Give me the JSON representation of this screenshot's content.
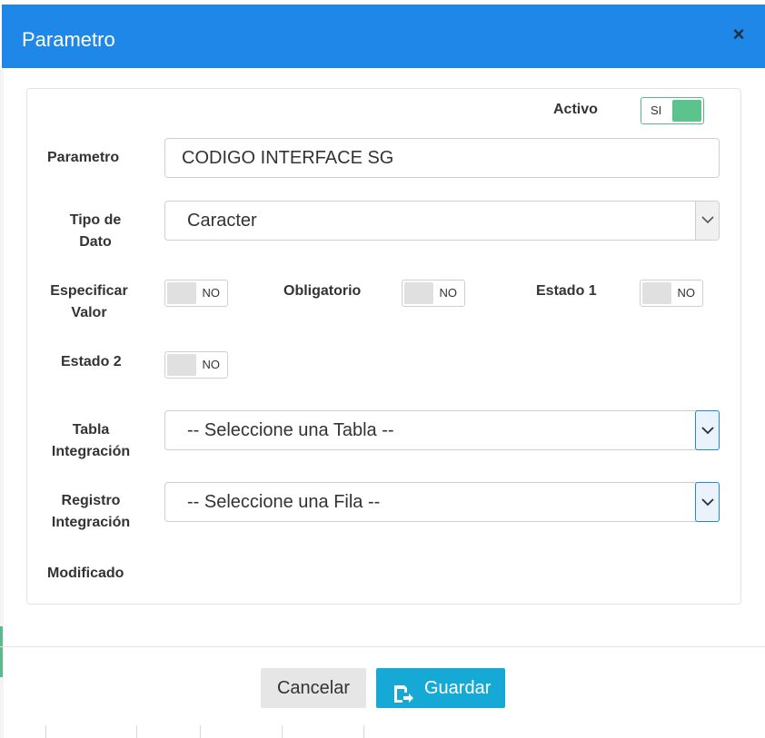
{
  "modal": {
    "title": "Parametro",
    "close_symbol": "×"
  },
  "form": {
    "activo": {
      "label": "Activo",
      "toggle_text": "SI",
      "state": "on"
    },
    "parametro": {
      "label": "Parametro",
      "value": "CODIGO INTERFACE SG"
    },
    "tipo_dato": {
      "label_line1": "Tipo de",
      "label_line2": "Dato",
      "selected": "Caracter"
    },
    "especificar_valor": {
      "label_line1": "Especificar",
      "label_line2": "Valor",
      "toggle_text": "NO"
    },
    "obligatorio": {
      "label": "Obligatorio",
      "toggle_text": "NO"
    },
    "estado1": {
      "label": "Estado 1",
      "toggle_text": "NO"
    },
    "estado2": {
      "label": "Estado 2",
      "toggle_text": "NO"
    },
    "tabla_integracion": {
      "label_line1": "Tabla",
      "label_line2": "Integración",
      "selected": "-- Seleccione una Tabla --"
    },
    "registro_integracion": {
      "label_line1": "Registro",
      "label_line2": "Integración",
      "selected": "-- Seleccione una Fila --"
    },
    "modificado": {
      "label": "Modificado"
    }
  },
  "footer": {
    "cancel_label": "Cancelar",
    "save_label": "Guardar"
  },
  "icons": {
    "close": "close-icon",
    "dropdown": "chevron-down-icon",
    "save": "save-icon"
  },
  "colors": {
    "header": "#1e87e8",
    "toggle_on": "#5cc38d",
    "save_button": "#17a9d6",
    "select_focus": "#1e87e8"
  }
}
